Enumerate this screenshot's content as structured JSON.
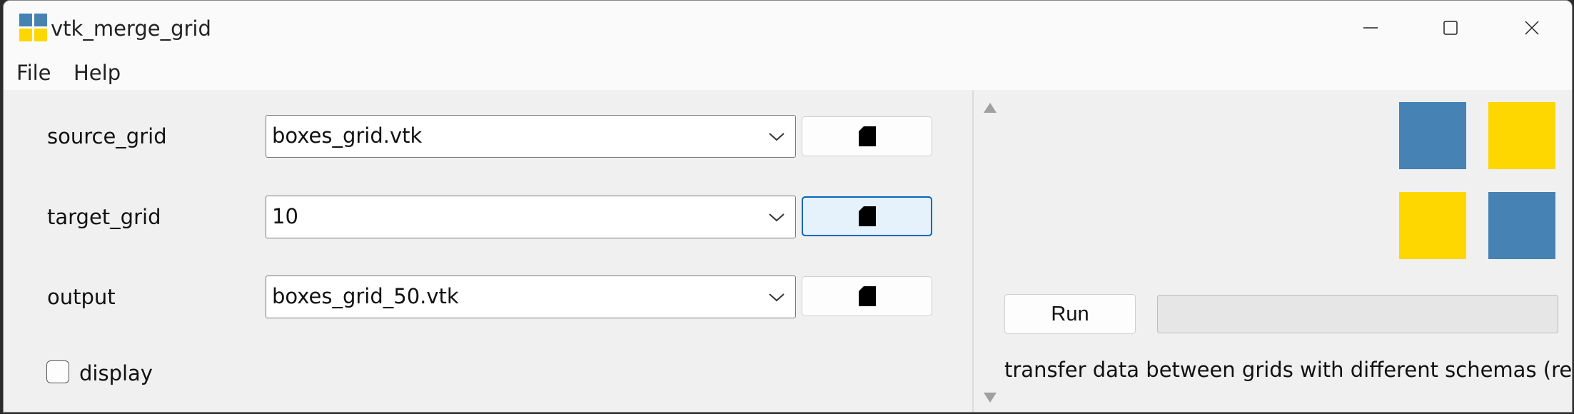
{
  "window": {
    "title": "vtk_merge_grid",
    "controls": [
      "minimize-icon",
      "maximize-icon",
      "close-icon"
    ]
  },
  "menu": [
    {
      "label": "File"
    },
    {
      "label": "Help"
    }
  ],
  "form": {
    "source_grid": {
      "label": "source_grid",
      "value": "boxes_grid.vtk",
      "browse_icon": "file-icon"
    },
    "target_grid": {
      "label": "target_grid",
      "value": "10",
      "browse_icon": "file-icon",
      "focused": true
    },
    "output": {
      "label": "output",
      "value": "boxes_grid_50.vtk",
      "browse_icon": "file-icon"
    },
    "display": {
      "label": "display",
      "checked": false
    }
  },
  "logo_colors": {
    "blue": "#4682b4",
    "yellow": "#ffd700"
  },
  "run": {
    "label": "Run",
    "progress": 0,
    "description": "transfer data between grids with different schemas (reblock)"
  }
}
